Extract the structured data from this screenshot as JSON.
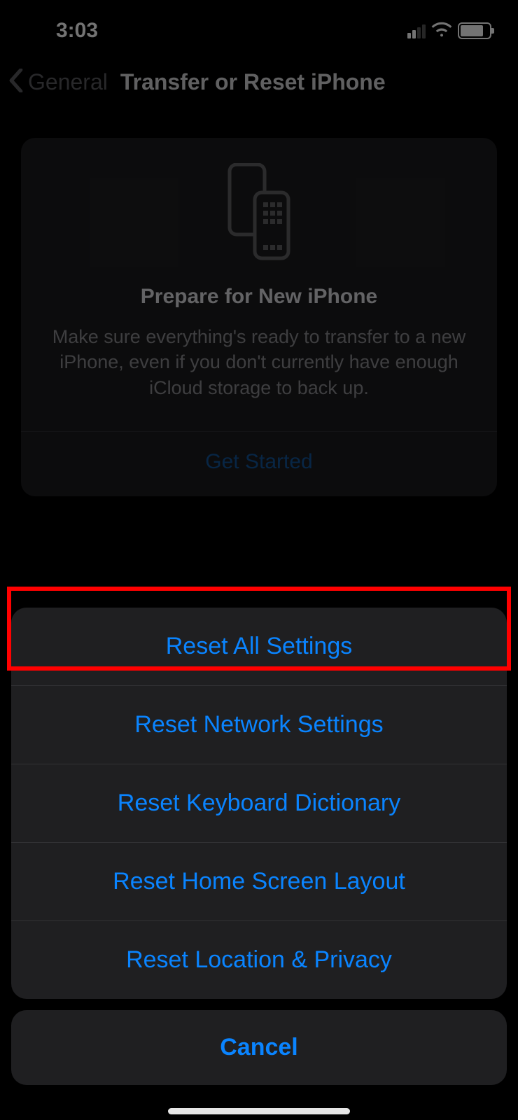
{
  "statusBar": {
    "time": "3:03"
  },
  "nav": {
    "back_label": "General",
    "title": "Transfer or Reset iPhone"
  },
  "prepareCard": {
    "title": "Prepare for New iPhone",
    "description": "Make sure everything's ready to transfer to a new iPhone, even if you don't currently have enough iCloud storage to back up.",
    "cta": "Get Started"
  },
  "actionSheet": {
    "items": [
      "Reset All Settings",
      "Reset Network Settings",
      "Reset Keyboard Dictionary",
      "Reset Home Screen Layout",
      "Reset Location & Privacy"
    ],
    "cancel": "Cancel"
  },
  "colors": {
    "accent": "#0a84ff",
    "highlight": "#ff0000"
  }
}
